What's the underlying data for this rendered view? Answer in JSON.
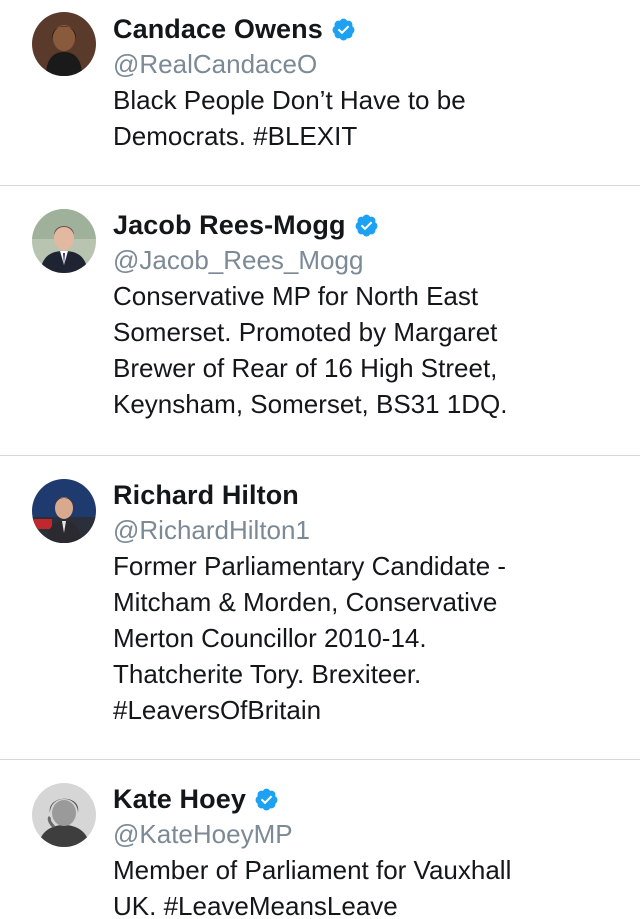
{
  "colors": {
    "verified_badge": "#1da1f2",
    "handle_text": "#7c8a96",
    "primary_text": "#14171a",
    "divider": "#d8d8d8"
  },
  "accounts": [
    {
      "name": "Candace Owens",
      "verified": true,
      "handle": "@RealCandaceO",
      "bio_lines": [
        "Black People Don’t Have to be",
        "Democrats. #BLEXIT"
      ]
    },
    {
      "name": "Jacob Rees-Mogg",
      "verified": true,
      "handle": "@Jacob_Rees_Mogg",
      "bio_lines": [
        "Conservative MP for North East",
        "Somerset. Promoted by Margaret",
        "Brewer of Rear of 16 High Street,",
        "Keynsham, Somerset, BS31 1DQ."
      ]
    },
    {
      "name": "Richard Hilton",
      "verified": false,
      "handle": "@RichardHilton1",
      "bio_lines": [
        "Former Parliamentary Candidate -",
        "Mitcham & Morden, Conservative",
        "Merton Councillor 2010-14.",
        "Thatcherite Tory. Brexiteer.",
        "#LeaversOfBritain"
      ]
    },
    {
      "name": "Kate Hoey",
      "verified": true,
      "handle": "@KateHoeyMP",
      "bio_lines": [
        "Member of Parliament for Vauxhall",
        "UK. #LeaveMeansLeave"
      ]
    }
  ]
}
